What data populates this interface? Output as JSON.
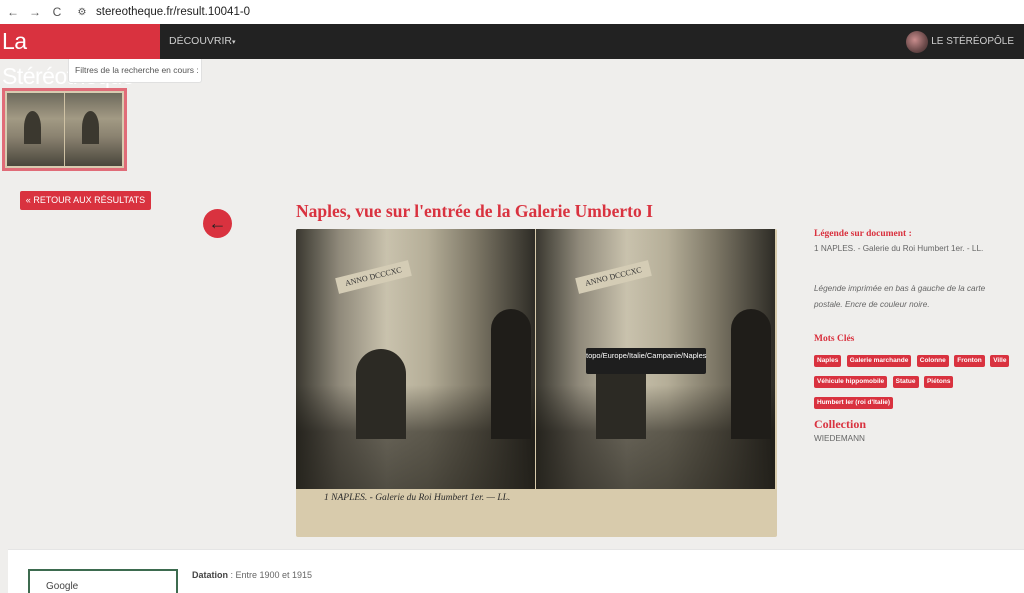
{
  "browser": {
    "back_icon": "←",
    "forward_icon": "→",
    "reload_icon": "C",
    "site_info_icon": "⚙",
    "url": "stereotheque.fr/result.10041-0"
  },
  "navbar": {
    "logo": "La Stéréothèque",
    "discover": "DÉCOUVRIR",
    "stereopole": "LE STÉRÉOPÔLE"
  },
  "filters": {
    "label": "Filtres de la recherche en cours :"
  },
  "back_button": {
    "label": "RETOUR AUX RÉSULTATS",
    "icon": "«"
  },
  "prev_arrow": {
    "icon": "←"
  },
  "title": "Naples, vue sur l'entrée de la Galerie Umberto I",
  "photo": {
    "banner_text": "ANNO DCCCXC",
    "caption": "1  NAPLES. - Galerie du Roi Humbert 1er. — LL.",
    "tooltip": "topo/Europe/Italie/Campanie/Naples"
  },
  "details": {
    "legend_heading": "Légende sur document :",
    "legend_text": "1 NAPLES. - Galerie du Roi Humbert 1er. - LL.",
    "legend_note": "Légende imprimée en bas à gauche de la carte postale. Encre de couleur noire.",
    "keywords_heading": "Mots Clés",
    "keywords": [
      "Naples",
      "Galerie marchande",
      "Colonne",
      "Fronton",
      "Ville",
      "Véhicule hippomobile",
      "Statue",
      "Piétons",
      "Humbert Ier (roi d'Italie)"
    ],
    "collection_heading": "Collection",
    "collection_value": "WIEDEMANN"
  },
  "bottom": {
    "map_label": "Google",
    "datation_label": "Datation",
    "datation_value": " : Entre 1900 et 1915"
  }
}
